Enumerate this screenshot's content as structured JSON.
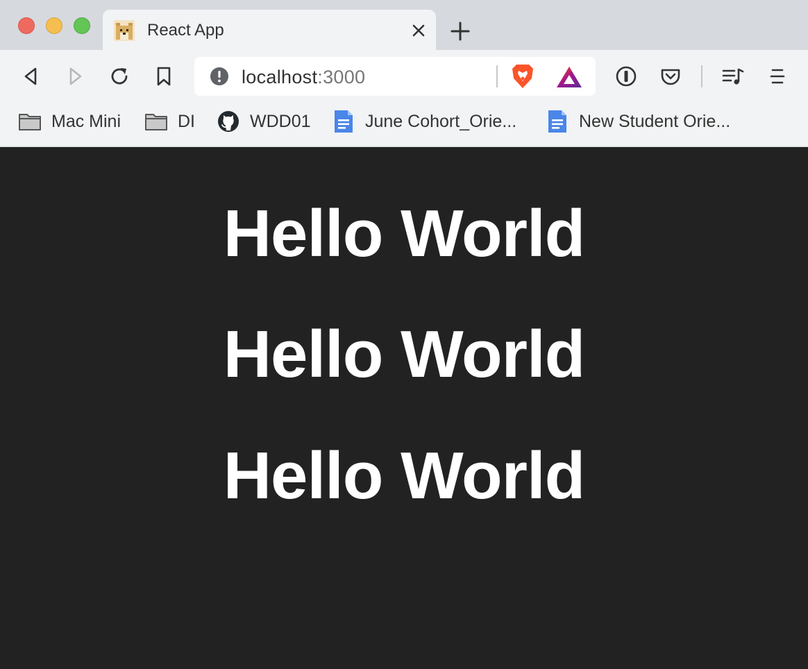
{
  "browser": {
    "tab": {
      "title": "React App",
      "favicon": "doge-favicon"
    },
    "omnibox": {
      "host": "localhost",
      "port": ":3000"
    },
    "icons": {
      "back": "back-arrow-icon",
      "forward": "forward-arrow-icon",
      "reload": "reload-icon",
      "bookmark": "bookmark-icon",
      "brave_shields": "brave-lion-icon",
      "brave_rewards": "bat-triangle-icon",
      "password_manager": "1password-icon",
      "pocket": "pocket-icon",
      "media": "media-playlist-icon",
      "menu": "hamburger-menu-icon"
    },
    "bookmarks": [
      {
        "label": "Mac Mini",
        "icon": "folder-icon"
      },
      {
        "label": "DI",
        "icon": "folder-icon"
      },
      {
        "label": "WDD01",
        "icon": "github-icon"
      },
      {
        "label": "June Cohort_Orie...",
        "icon": "google-docs-icon"
      },
      {
        "label": "New Student Orie...",
        "icon": "google-docs-icon"
      }
    ]
  },
  "page": {
    "background": "#222222",
    "headings": [
      "Hello World",
      "Hello World",
      "Hello World"
    ]
  },
  "colors": {
    "traffic_close": "#ee6a5f",
    "traffic_minimize": "#f5be4f",
    "traffic_maximize": "#62c555",
    "docs_blue": "#4a86e8",
    "brave_orange": "#fb542b"
  }
}
